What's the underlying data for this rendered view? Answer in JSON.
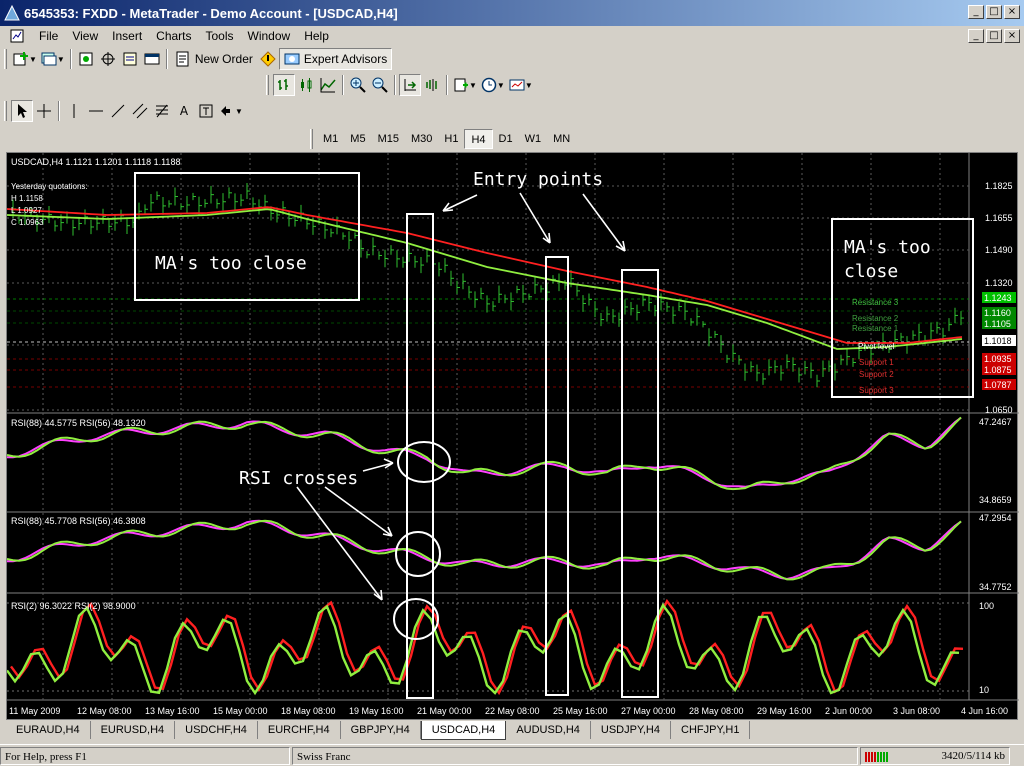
{
  "window": {
    "title": "6545353: FXDD - MetaTrader - Demo Account - [USDCAD,H4]",
    "minimize": "_",
    "maximize": "□",
    "close": "×"
  },
  "menu": [
    "File",
    "View",
    "Insert",
    "Charts",
    "Tools",
    "Window",
    "Help"
  ],
  "toolbar": {
    "new_order": "New Order",
    "expert_advisors": "Expert Advisors"
  },
  "timeframes": [
    "M1",
    "M5",
    "M15",
    "M30",
    "H1",
    "H4",
    "D1",
    "W1",
    "MN"
  ],
  "active_timeframe": "H4",
  "chart": {
    "header": "USDCAD,H4  1.1121 1.1201 1.1118 1.1188",
    "quotes": {
      "label": "Yesterday quotations:",
      "high": "H 1.1158",
      "low": "L 1.0927",
      "close": "C 1.0963"
    },
    "price_axis": [
      "1.1825",
      "1.1655",
      "1.1490",
      "1.1320",
      "1.0650"
    ],
    "price_badges": [
      {
        "text": "1.1243",
        "color": "#00c000"
      },
      {
        "text": "1.1160",
        "color": "#008800"
      },
      {
        "text": "1.1105",
        "color": "#008800"
      },
      {
        "text": "1.1018",
        "color": "#ffffff"
      },
      {
        "text": "1.0935",
        "color": "#cc0000"
      },
      {
        "text": "1.0875",
        "color": "#cc0000"
      },
      {
        "text": "1.0787",
        "color": "#cc0000"
      }
    ],
    "pivot_labels": {
      "r3": "Resistance 3",
      "r2": "Resistance 2",
      "r1": "Resistance 1",
      "pp": "Pivot level",
      "s1": "Support 1",
      "s2": "Support 2",
      "s3": "Support 3"
    },
    "rsi1": {
      "header": "RSI(88) 44.5775  RSI(56) 48.1320",
      "max": "47.2467",
      "min": "34.8659"
    },
    "rsi2": {
      "header": "RSI(88) 45.7708  RSI(56) 46.3808",
      "max": "47.2954",
      "min": "34.7752"
    },
    "rsi3": {
      "header": "RSI(2) 96.3022  RSI(2) 98.9000",
      "max": "100",
      "min": "10"
    },
    "time_axis": [
      "11 May 2009",
      "12 May 08:00",
      "13 May 16:00",
      "15 May 00:00",
      "18 May 08:00",
      "19 May 16:00",
      "21 May 00:00",
      "22 May 08:00",
      "25 May 16:00",
      "27 May 00:00",
      "28 May 08:00",
      "29 May 16:00",
      "2 Jun 00:00",
      "3 Jun 08:00",
      "4 Jun 16:00"
    ],
    "annotations": {
      "ma_close_1": "MA's too close",
      "ma_close_2a": "MA's too",
      "ma_close_2b": "close",
      "entry_points": "Entry points",
      "rsi_crosses": "RSI crosses"
    }
  },
  "tabs": [
    "EURAUD,H4",
    "EURUSD,H4",
    "USDCHF,H4",
    "EURCHF,H4",
    "GBPJPY,H4",
    "USDCAD,H4",
    "AUDUSD,H4",
    "USDJPY,H4",
    "CHFJPY,H1"
  ],
  "active_tab": "USDCAD,H4",
  "status": {
    "help": "For Help, press F1",
    "profile": "Swiss Franc",
    "traffic": "3420/5/114 kb"
  },
  "colors": {
    "ma_fast": "#ff2020",
    "ma_slow": "#90ee40",
    "rsi_fast": "#ff40ff",
    "rsi_slow": "#90ee40"
  }
}
